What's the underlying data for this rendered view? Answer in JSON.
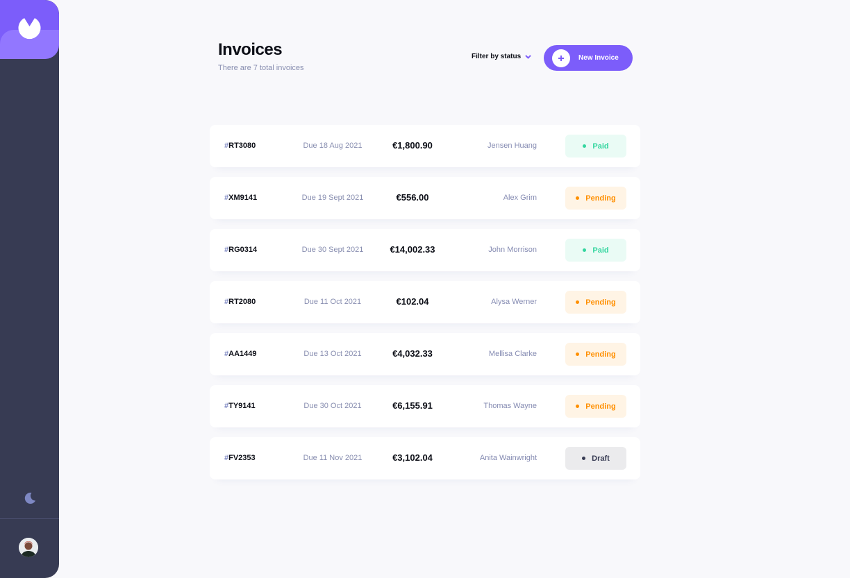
{
  "header": {
    "title": "Invoices",
    "subtitle": "There are 7 total invoices",
    "filter_label": "Filter by status",
    "new_invoice_label": "New Invoice"
  },
  "sidebar": {
    "logo_icon": "logo-icon",
    "theme_icon": "moon-icon",
    "avatar_icon": "avatar"
  },
  "colors": {
    "accent": "#7C5DFA",
    "sidebar": "#373B53",
    "paid": "#33D69F",
    "pending": "#FF8F00",
    "draft": "#373B53"
  },
  "invoices": [
    {
      "hash": "#",
      "id": "RT3080",
      "due": "Due 18 Aug 2021",
      "amount": "€1,800.90",
      "client": "Jensen Huang",
      "status": "Paid",
      "status_key": "paid"
    },
    {
      "hash": "#",
      "id": "XM9141",
      "due": "Due 19 Sept 2021",
      "amount": "€556.00",
      "client": "Alex Grim",
      "status": "Pending",
      "status_key": "pending"
    },
    {
      "hash": "#",
      "id": "RG0314",
      "due": "Due 30 Sept 2021",
      "amount": "€14,002.33",
      "client": "John Morrison",
      "status": "Paid",
      "status_key": "paid"
    },
    {
      "hash": "#",
      "id": "RT2080",
      "due": "Due 11 Oct 2021",
      "amount": "€102.04",
      "client": "Alysa Werner",
      "status": "Pending",
      "status_key": "pending"
    },
    {
      "hash": "#",
      "id": "AA1449",
      "due": "Due 13 Oct 2021",
      "amount": "€4,032.33",
      "client": "Mellisa Clarke",
      "status": "Pending",
      "status_key": "pending"
    },
    {
      "hash": "#",
      "id": "TY9141",
      "due": "Due 30 Oct 2021",
      "amount": "€6,155.91",
      "client": "Thomas Wayne",
      "status": "Pending",
      "status_key": "pending"
    },
    {
      "hash": "#",
      "id": "FV2353",
      "due": "Due 11 Nov 2021",
      "amount": "€3,102.04",
      "client": "Anita Wainwright",
      "status": "Draft",
      "status_key": "draft"
    }
  ]
}
